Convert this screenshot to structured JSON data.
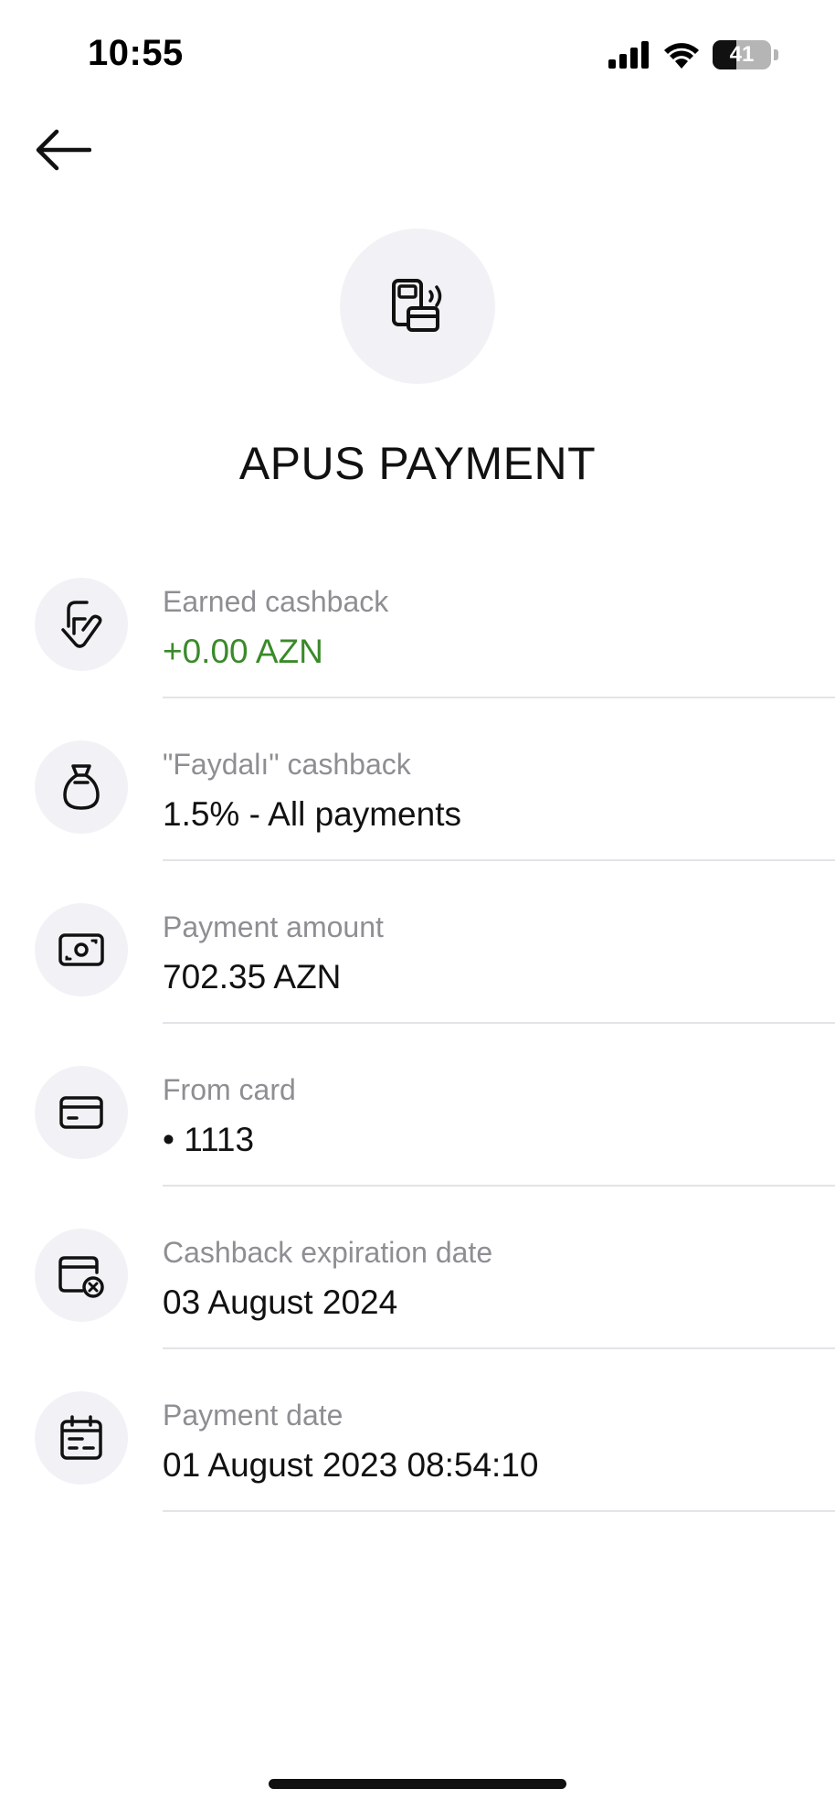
{
  "status_bar": {
    "time": "10:55",
    "battery_level": "41",
    "battery_fraction": 0.41,
    "icons": [
      "signal-icon",
      "wifi-icon",
      "battery-icon"
    ]
  },
  "header": {
    "back_icon": "arrow-left-icon",
    "merchant_icon": "pos-terminal-icon",
    "title": "APUS PAYMENT"
  },
  "colors": {
    "positive": "#3a8a2a",
    "label": "#8e8e93",
    "icon_bg": "#f2f2f6"
  },
  "details": [
    {
      "icon": "cashback-icon",
      "label": "Earned cashback",
      "value": "+0.00 AZN",
      "positive": true
    },
    {
      "icon": "money-bag-icon",
      "label": "\"Faydalı\" cashback",
      "value": "1.5% - All payments"
    },
    {
      "icon": "banknote-icon",
      "label": "Payment amount",
      "value": "702.35 AZN"
    },
    {
      "icon": "card-icon",
      "label": "From card",
      "value": "• 1113"
    },
    {
      "icon": "calendar-x-icon",
      "label": "Cashback expiration date",
      "value": "03 August 2024"
    },
    {
      "icon": "calendar-icon",
      "label": "Payment date",
      "value": "01 August 2023 08:54:10"
    }
  ]
}
